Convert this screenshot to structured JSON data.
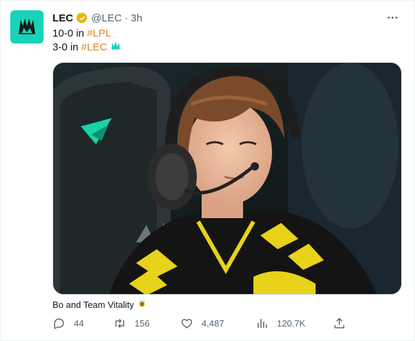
{
  "tweet": {
    "author_name": "LEC",
    "handle": "@LEC",
    "separator": "·",
    "time": "3h",
    "lines": [
      {
        "prefix": "10-0 in ",
        "hashtag": "#LPL"
      },
      {
        "prefix": "3-0 in ",
        "hashtag": "#LEC"
      }
    ],
    "caption": "Bo and Team Vitality"
  },
  "actions": {
    "replies": "44",
    "retweets": "156",
    "likes": "4,487",
    "views": "120.7K"
  },
  "icons": {
    "avatar": "lec-logo-icon",
    "verified": "verified-badge-icon",
    "more": "more-icon",
    "reply": "reply-icon",
    "retweet": "retweet-icon",
    "like": "like-icon",
    "views": "views-icon",
    "share": "share-icon",
    "hashtag_emoji": "lec-crown-icon",
    "caption_emoji": "bee-icon"
  },
  "colors": {
    "accent": "#1d9bf0",
    "hashtag": "#e0832a",
    "brand": "#17d4b8",
    "muted": "#536471"
  }
}
